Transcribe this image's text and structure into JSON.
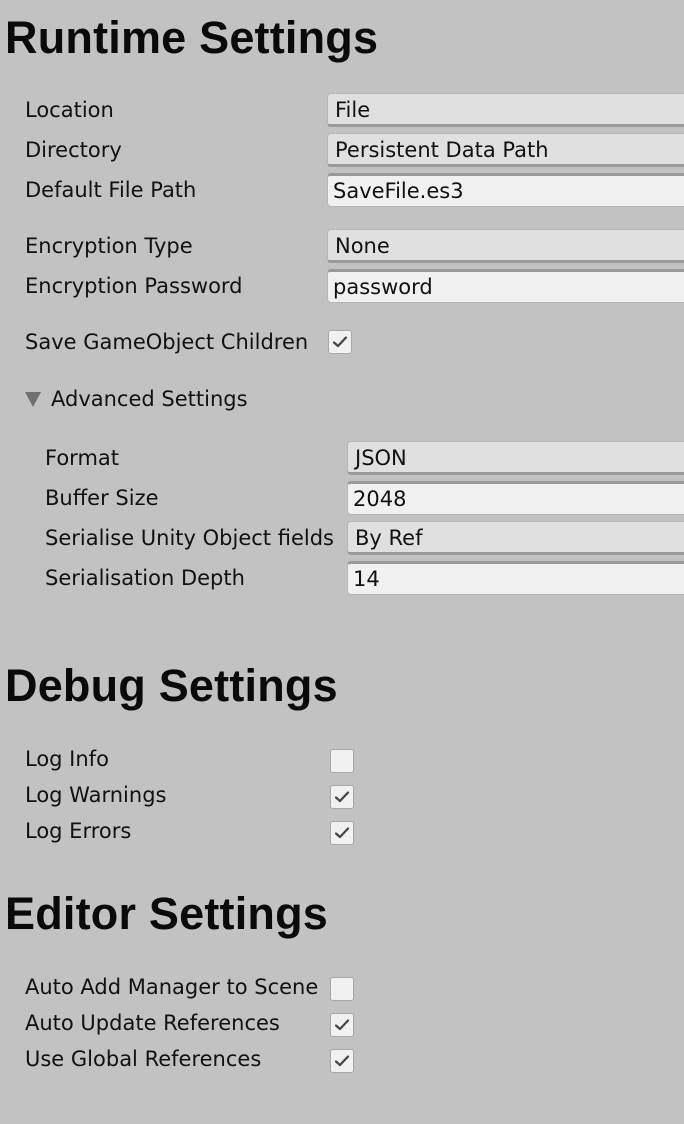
{
  "runtime": {
    "title": "Runtime Settings",
    "location": {
      "label": "Location",
      "value": "File"
    },
    "directory": {
      "label": "Directory",
      "value": "Persistent Data Path"
    },
    "default_file_path": {
      "label": "Default File Path",
      "value": "SaveFile.es3"
    },
    "encryption_type": {
      "label": "Encryption Type",
      "value": "None"
    },
    "encryption_password": {
      "label": "Encryption Password",
      "value": "password"
    },
    "save_children": {
      "label": "Save GameObject Children",
      "checked": true
    },
    "advanced": {
      "label": "Advanced Settings",
      "expanded": true,
      "format": {
        "label": "Format",
        "value": "JSON"
      },
      "buffer_size": {
        "label": "Buffer Size",
        "value": "2048"
      },
      "serialise_unity_object_fields": {
        "label": "Serialise Unity Object fields",
        "value": "By Ref"
      },
      "serialisation_depth": {
        "label": "Serialisation Depth",
        "value": "14"
      }
    }
  },
  "debug": {
    "title": "Debug Settings",
    "log_info": {
      "label": "Log Info",
      "checked": false
    },
    "log_warnings": {
      "label": "Log Warnings",
      "checked": true
    },
    "log_errors": {
      "label": "Log Errors",
      "checked": true
    }
  },
  "editor": {
    "title": "Editor Settings",
    "auto_add_manager": {
      "label": "Auto Add Manager to Scene",
      "checked": false
    },
    "auto_update_references": {
      "label": "Auto Update References",
      "checked": true
    },
    "use_global_references": {
      "label": "Use Global References",
      "checked": true
    }
  },
  "icons": {
    "check": "checkmark-icon",
    "foldout": "triangle-down-icon"
  }
}
